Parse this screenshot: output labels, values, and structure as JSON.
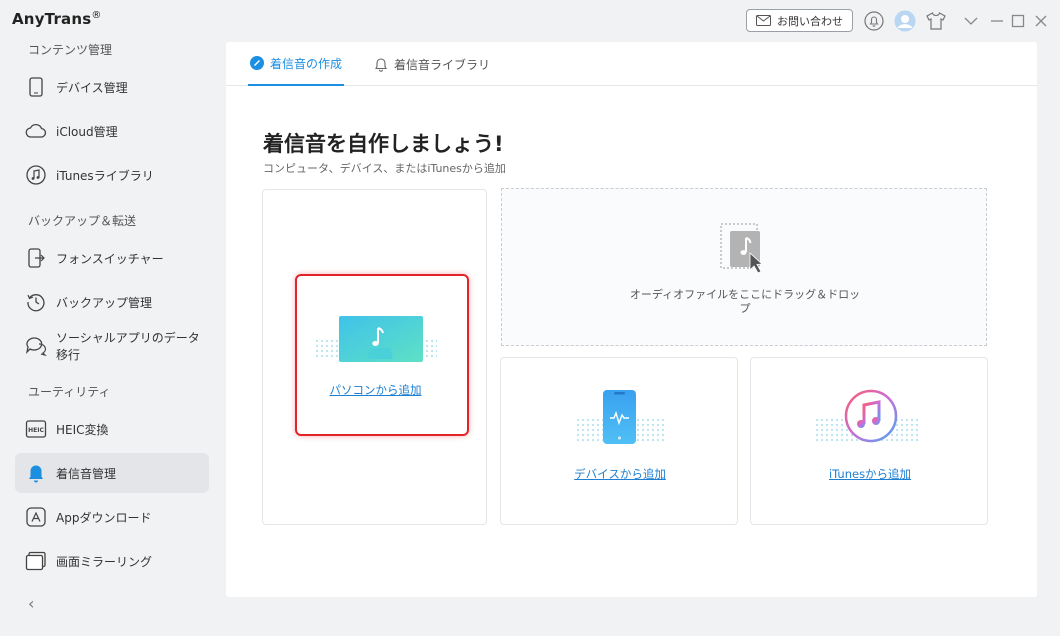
{
  "app": {
    "name": "AnyTrans",
    "reg": "®"
  },
  "titlebar": {
    "contact_label": "お問い合わせ"
  },
  "sidebar": {
    "sections": [
      {
        "label": "コンテンツ管理"
      },
      {
        "label": "バックアップ＆転送"
      },
      {
        "label": "ユーティリティ"
      }
    ],
    "items": [
      {
        "label": "デバイス管理"
      },
      {
        "label": "iCloud管理"
      },
      {
        "label": "iTunesライブラリ"
      },
      {
        "label": "フォンスイッチャー"
      },
      {
        "label": "バックアップ管理"
      },
      {
        "label": "ソーシャルアプリのデータ移行"
      },
      {
        "label": "HEIC変換"
      },
      {
        "label": "着信音管理"
      },
      {
        "label": "Appダウンロード"
      },
      {
        "label": "画面ミラーリング"
      }
    ],
    "heic_icon_text": "HEIC",
    "collapse_glyph": "‹"
  },
  "tabs": [
    {
      "label": "着信音の作成"
    },
    {
      "label": "着信音ライブラリ"
    }
  ],
  "main": {
    "heading": "着信音を自作しましょう!",
    "subheading": "コンピュータ、デバイス、またはiTunesから追加",
    "pc_link": "パソコンから追加",
    "drop_line1": "オーディオファイルをここにドラッグ＆ドロッ",
    "drop_line2": "プ",
    "device_link": "デバイスから追加",
    "itunes_link": "iTunesから追加"
  },
  "colors": {
    "accent": "#1d8fe0",
    "highlight": "#e2232a",
    "active_bg": "#e3e5e8"
  }
}
